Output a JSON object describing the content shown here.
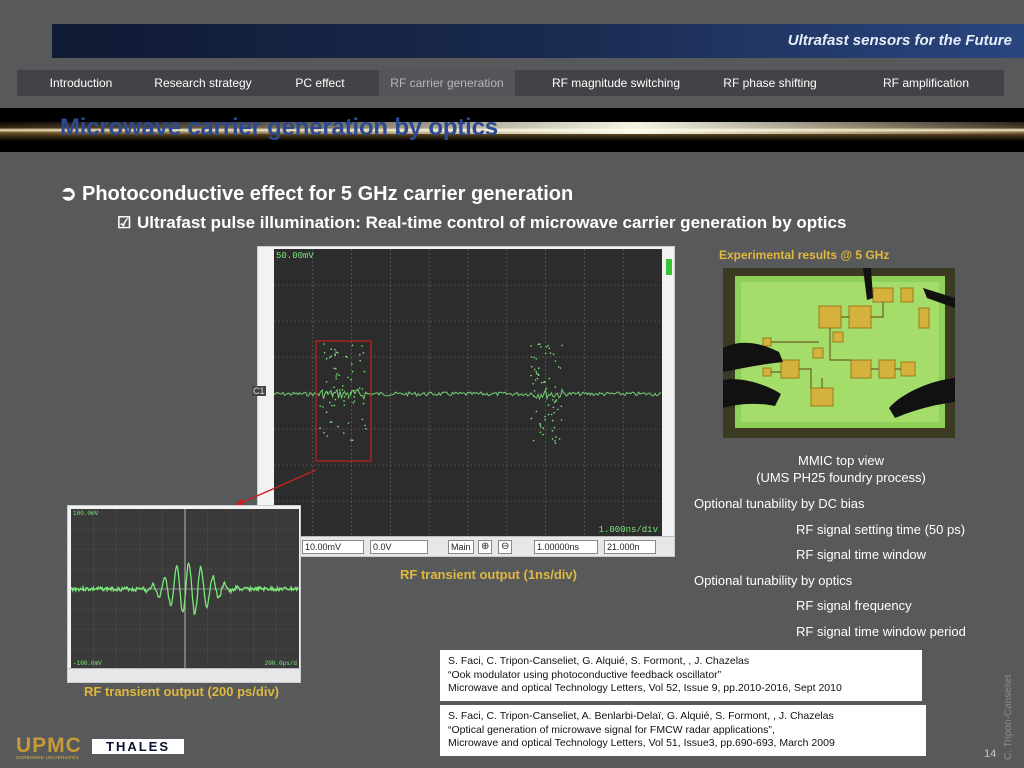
{
  "header": {
    "title": "Ultrafast sensors for the Future"
  },
  "nav": {
    "tabs": [
      {
        "label": "Introduction"
      },
      {
        "label": "Research strategy"
      },
      {
        "label": "PC effect"
      },
      {
        "label": "RF carrier generation"
      },
      {
        "label": "RF  magnitude switching"
      },
      {
        "label": "RF  phase shifting"
      },
      {
        "label": "RF  amplification"
      }
    ]
  },
  "page_title": "Microwave carrier generation by optics",
  "bullet1": {
    "text": "Photoconductive effect for 5 GHz carrier generation"
  },
  "bullet2": {
    "text": "Ultrafast pulse illumination: Real-time control of microwave carrier generation by optics"
  },
  "scope": {
    "top_label": "50.00mV",
    "ch_marker": "C1",
    "bottom_left_label": "V",
    "bottom_right_label": "1.000ns/div",
    "fields": [
      "10.00mV",
      "0.0V",
      "Main",
      "1.00000ns",
      "21.000n"
    ],
    "caption": "RF transient output (1ns/div)"
  },
  "small_scope": {
    "top_label": "100.0mV",
    "bottom_left_label": "-100.0mV",
    "bottom_right_label": "200.0ps/d",
    "caption": "RF transient output (200 ps/div)"
  },
  "experimental": {
    "title": "Experimental results @ 5 GHz",
    "chip_caption_line1": "MMIC top view",
    "chip_caption_line2": "(UMS PH25 foundry process)"
  },
  "tunability": [
    {
      "text": "Optional tunability by DC bias"
    },
    {
      "text": "RF signal setting time (50 ps)"
    },
    {
      "text": "RF signal time window"
    },
    {
      "text": "Optional tunability by optics"
    },
    {
      "text": "RF signal frequency"
    },
    {
      "text": "RF signal time window period"
    }
  ],
  "references": [
    {
      "line1": "S. Faci, C. Tripon-Canseliet, G. Alquié, S. Formont, , J. Chazelas",
      "line2": "“Ook modulator using photoconductive feedback oscillator”",
      "line3": "Microwave and optical Technology Letters, Vol 52, Issue 9, pp.2010-2016, Sept 2010"
    },
    {
      "line1": "S. Faci, C. Tripon-Canseliet, A. Benlarbi-Delaï, G. Alquié, S. Formont, , J. Chazelas",
      "line2": "“Optical generation of microwave signal for FMCW radar applications”,",
      "line3": "Microwave and optical Technology Letters, Vol 51, Issue3, pp.690-693, March 2009"
    }
  ],
  "footer": {
    "author": "C. Tripon-Canseliet",
    "page": "14",
    "logo_upmc": "UPMC",
    "logo_upmc_sub": "SORBONNE UNIVERSITÉS",
    "logo_thales": "THALES"
  },
  "colors": {
    "background": "#58595b",
    "title_blue": "#2b4a93",
    "caption_gold": "#e0b83e",
    "trace_green": "#7ae87a"
  }
}
